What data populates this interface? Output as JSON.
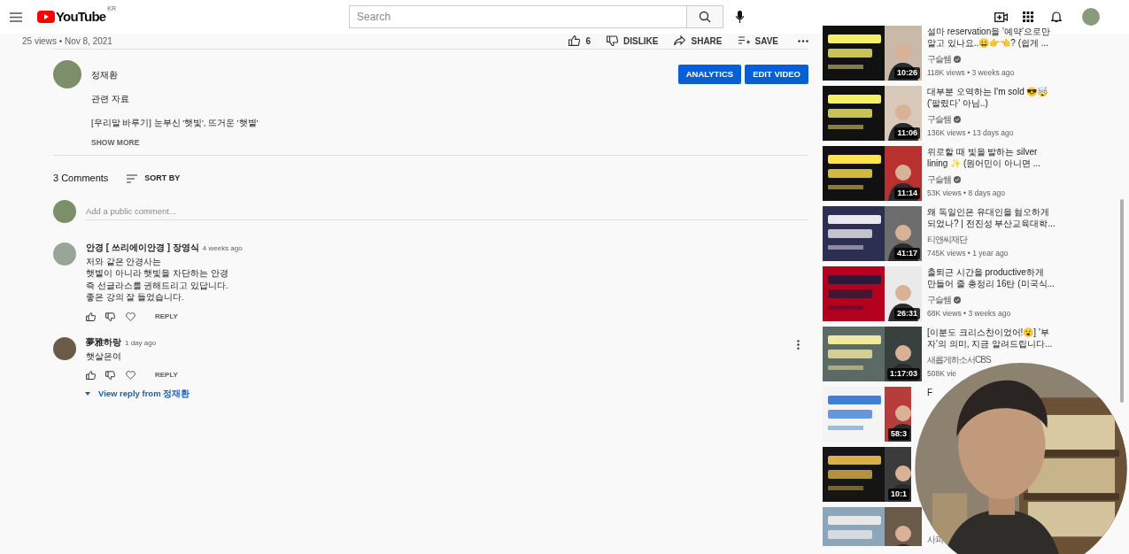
{
  "header": {
    "logo": "YouTube",
    "region": "KR",
    "search": {
      "placeholder": "Search"
    }
  },
  "video": {
    "meta": "25 views • Nov 8, 2021",
    "likes": "6",
    "actions": [
      {
        "kind": "dislike",
        "label": "DISLIKE"
      },
      {
        "kind": "share",
        "label": "SHARE"
      },
      {
        "kind": "save",
        "label": "SAVE"
      }
    ]
  },
  "channel": {
    "name": "정재환",
    "buttons": [
      "ANALYTICS",
      "EDIT VIDEO"
    ]
  },
  "description": [
    "관련 자료",
    "[우리말 바루기] 눈부신 '햇빛', 뜨거운 '햇볕'"
  ],
  "show_more": "SHOW MORE",
  "comments": {
    "count": "3 Comments",
    "sort": "SORT BY",
    "placeholder": "Add a public comment...",
    "items": [
      {
        "author": "안경 [ 쓰리에이안경 ] 장영식",
        "time": "4 weeks ago",
        "lines": [
          "저와 같은 안경사는",
          "햇볕이 아니라 햇빛을 차단하는 안경",
          "즉 선글라스를 권해드리고 있답니다.",
          "좋은 강의 잘 들었습니다."
        ],
        "reply": "REPLY",
        "menu": false
      },
      {
        "author": "夢雅하랑",
        "time": "1 day ago",
        "lines": [
          "햇살은여"
        ],
        "reply": "REPLY",
        "menu": true
      }
    ],
    "view_reply": "View reply from 정재환"
  },
  "sidebar": [
    {
      "duration": "10:26",
      "title_lines": [
        "설마 reservation을 '예약'으로만",
        "알고 있나요..😀👉👈? (쉽게 ..."
      ],
      "channel": "구슬쌤",
      "verified": true,
      "meta": "118K views • 3 weeks ago"
    },
    {
      "duration": "11:06",
      "title_lines": [
        "대부분 오역하는 I'm sold 😎🤯",
        "('팔렸다' 아님..)"
      ],
      "channel": "구슬쌤",
      "verified": true,
      "meta": "136K views • 13 days ago"
    },
    {
      "duration": "11:14",
      "title_lines": [
        "위로할 때 빛을 발하는 silver",
        "lining ✨ (원어민이 아니면 ..."
      ],
      "channel": "구슬쌤",
      "verified": true,
      "meta": "53K views • 8 days ago"
    },
    {
      "duration": "41:17",
      "title_lines": [
        "왜 독일인은 유대인을 혐오하게",
        "되었나? | 전진성 부산교육대학..."
      ],
      "channel": "티앤씨재단",
      "verified": false,
      "meta": "745K views • 1 year ago"
    },
    {
      "duration": "26:31",
      "title_lines": [
        "출퇴근 시간을 productive하게",
        "만들어 줄 총정리 16탄 (미국식..."
      ],
      "channel": "구슬쌤",
      "verified": true,
      "meta": "68K views • 3 weeks ago"
    },
    {
      "duration": "1:17:03",
      "title_lines": [
        "[이분도 크리스찬이었어!😮] '부",
        "자'의 의미, 지금 알려드립니다..."
      ],
      "channel": "새롭게하소서CBS",
      "verified": false,
      "meta": "508K vie"
    },
    {
      "duration": "58:3",
      "title_lines": [
        "F"
      ]
    },
    {
      "duration": "10:1"
    },
    {
      "channel": "사피",
      "verified": false
    }
  ]
}
